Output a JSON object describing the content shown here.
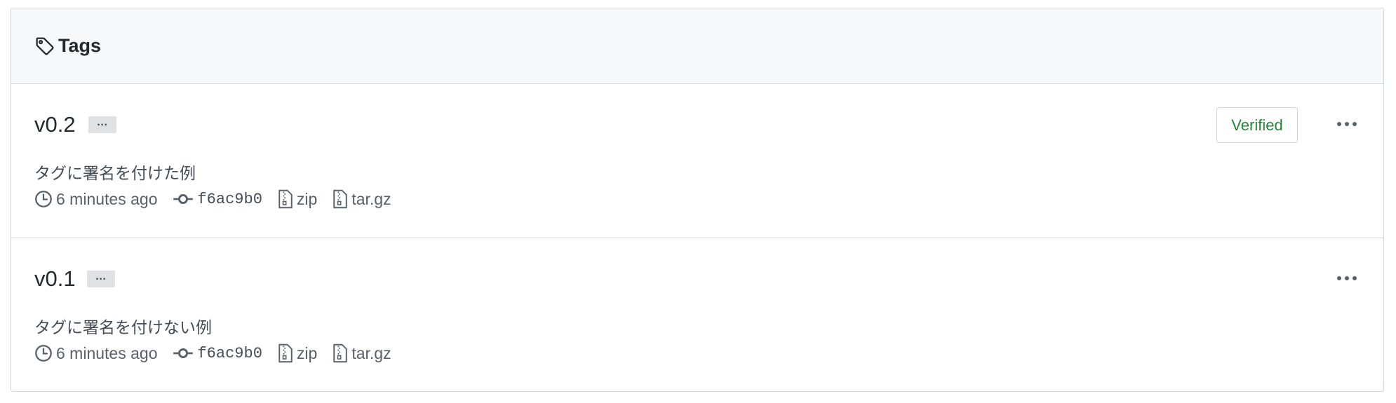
{
  "header": {
    "title": "Tags",
    "icon": "tag-icon"
  },
  "tags": [
    {
      "name": "v0.2",
      "ellipsis": "…",
      "message": "タグに署名を付けた例",
      "time": "6 minutes ago",
      "sha": "f6ac9b0",
      "zip": "zip",
      "targz": "tar.gz",
      "verified": "Verified"
    },
    {
      "name": "v0.1",
      "ellipsis": "…",
      "message": "タグに署名を付けない例",
      "time": "6 minutes ago",
      "sha": "f6ac9b0",
      "zip": "zip",
      "targz": "tar.gz"
    }
  ],
  "colors": {
    "verified_green": "#22863a",
    "border": "#d1d5da",
    "header_bg": "#f6f8fa"
  }
}
